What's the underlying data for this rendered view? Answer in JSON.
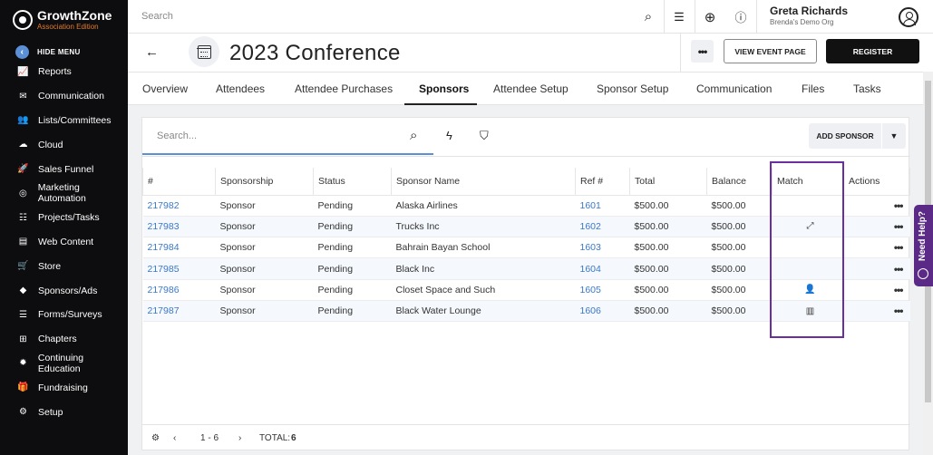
{
  "brand": {
    "name": "GrowthZone",
    "edition": "Association Edition",
    "accent": "#e07a2e"
  },
  "sidebar": {
    "hide_label": "HIDE MENU",
    "items": [
      {
        "label": "Reports",
        "icon": "chart-icon"
      },
      {
        "label": "Communication",
        "icon": "envelope-icon"
      },
      {
        "label": "Lists/Committees",
        "icon": "users-icon"
      },
      {
        "label": "Cloud",
        "icon": "cloud-icon"
      },
      {
        "label": "Sales Funnel",
        "icon": "rocket-icon"
      },
      {
        "label": "Marketing Automation",
        "icon": "target-icon"
      },
      {
        "label": "Projects/Tasks",
        "icon": "checklist-icon"
      },
      {
        "label": "Web Content",
        "icon": "web-icon"
      },
      {
        "label": "Store",
        "icon": "cart-icon"
      },
      {
        "label": "Sponsors/Ads",
        "icon": "gem-icon"
      },
      {
        "label": "Forms/Surveys",
        "icon": "list-icon"
      },
      {
        "label": "Chapters",
        "icon": "sitemap-icon"
      },
      {
        "label": "Continuing Education",
        "icon": "badge-icon"
      },
      {
        "label": "Fundraising",
        "icon": "gift-icon"
      },
      {
        "label": "Setup",
        "icon": "gear-icon"
      }
    ]
  },
  "topbar": {
    "search_placeholder": "Search",
    "user_name": "Greta Richards",
    "user_org": "Brenda's Demo Org"
  },
  "header": {
    "title": "2023 Conference",
    "more_label": "•••",
    "view_event_label": "VIEW EVENT PAGE",
    "register_label": "REGISTER"
  },
  "tabs": [
    "Overview",
    "Attendees",
    "Attendee Purchases",
    "Sponsors",
    "Attendee Setup",
    "Sponsor Setup",
    "Communication",
    "Files",
    "Tasks"
  ],
  "active_tab": "Sponsors",
  "toolbar": {
    "search_placeholder": "Search...",
    "add_sponsor_label": "ADD SPONSOR"
  },
  "table": {
    "columns": [
      "#",
      "Sponsorship",
      "Status",
      "Sponsor Name",
      "Ref #",
      "Total",
      "Balance",
      "Match",
      "Actions"
    ],
    "rows": [
      {
        "id": "217982",
        "sponsorship": "Sponsor",
        "status": "Pending",
        "name": "Alaska Airlines",
        "ref": "1601",
        "total": "$500.00",
        "balance": "$500.00",
        "match": ""
      },
      {
        "id": "217983",
        "sponsorship": "Sponsor",
        "status": "Pending",
        "name": "Trucks Inc",
        "ref": "1602",
        "total": "$500.00",
        "balance": "$500.00",
        "match": "link-icon"
      },
      {
        "id": "217984",
        "sponsorship": "Sponsor",
        "status": "Pending",
        "name": "Bahrain Bayan School",
        "ref": "1603",
        "total": "$500.00",
        "balance": "$500.00",
        "match": ""
      },
      {
        "id": "217985",
        "sponsorship": "Sponsor",
        "status": "Pending",
        "name": "Black Inc",
        "ref": "1604",
        "total": "$500.00",
        "balance": "$500.00",
        "match": ""
      },
      {
        "id": "217986",
        "sponsorship": "Sponsor",
        "status": "Pending",
        "name": "Closet Space and Such",
        "ref": "1605",
        "total": "$500.00",
        "balance": "$500.00",
        "match": "person-icon"
      },
      {
        "id": "217987",
        "sponsorship": "Sponsor",
        "status": "Pending",
        "name": "Black Water Lounge",
        "ref": "1606",
        "total": "$500.00",
        "balance": "$500.00",
        "match": "building-icon"
      }
    ],
    "actions_label": "•••"
  },
  "footer": {
    "page_range": "1 - 6",
    "total_label": "TOTAL:",
    "total_value": "6"
  },
  "help": {
    "label": "Need Help?",
    "color": "#5a2a86"
  },
  "highlight_color": "#6a2ea0"
}
